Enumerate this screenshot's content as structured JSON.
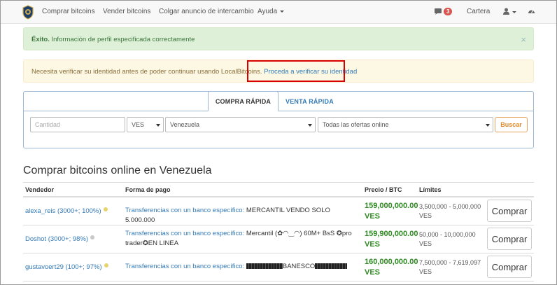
{
  "nav": {
    "items": [
      "Comprar bitcoins",
      "Vender bitcoins",
      "Colgar anuncio de intercambio",
      "Ayuda"
    ],
    "notifications_count": "3",
    "wallet": "Cartera"
  },
  "alerts": {
    "success_bold": "Éxito.",
    "success_text": " Información de perfil especificada correctamente",
    "close": "×",
    "warning_text": "Necesita verificar su identidad antes de poder continuar usando LocalBitcoins. ",
    "warning_link": "Proceda a verificar su identidad"
  },
  "search": {
    "tab_buy": "COMPRA RÁPIDA",
    "tab_sell": "VENTA RÁPIDA",
    "amount_placeholder": "Cantidad",
    "currency": "VES",
    "country": "Venezuela",
    "offers": "Todas las ofertas online",
    "button": "Buscar"
  },
  "heading": "Comprar bitcoins online en Venezuela",
  "table": {
    "headers": [
      "Vendedor",
      "Forma de pago",
      "Precio / BTC",
      "Límites"
    ],
    "rows": [
      {
        "seller": "alexa_reis (3000+; 100%)",
        "status_color": "#e6d36b",
        "pay_link": "Transferencias con un banco específico:",
        "pay_line1": " MERCANTIL VENDO SOLO 5.000.000",
        "pay_line2": "",
        "price": "159,000,000.00",
        "currency": "VES",
        "limit": "3,500,000 - 5,000,000",
        "limit_cur": "VES",
        "buy": "Comprar"
      },
      {
        "seller": "Doshot (3000+; 98%)",
        "status_color": "#c8c8c8",
        "pay_link": "Transferencias con un banco específico:",
        "pay_line1": " Mercantil (✿◠‿◠) 60M+ BsS ✪pro",
        "pay_line2": "trader✪EN LINEA",
        "price": "159,900,000.00",
        "currency": "VES",
        "limit": "50,000 - 10,000,000",
        "limit_cur": "VES",
        "buy": "Comprar"
      },
      {
        "seller": "gustavoert29 (100+; 97%)",
        "status_color": "#e6d36b",
        "pay_link": "Transferencias con un banco específico:",
        "pay_line1": "BANESCO",
        "pay_line2": "",
        "price": "160,000,000.00",
        "currency": "VES",
        "limit": "7,500,000 - 7,619,097",
        "limit_cur": "VES",
        "buy": "Comprar"
      }
    ]
  }
}
